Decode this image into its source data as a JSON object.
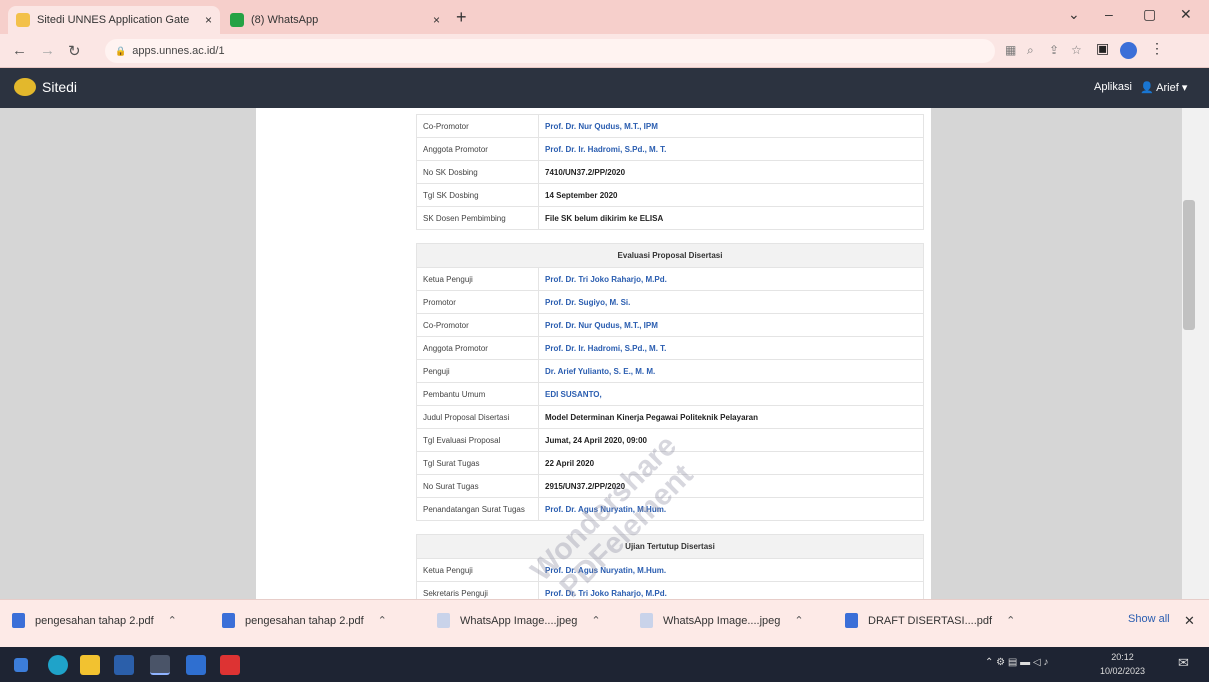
{
  "browser": {
    "tabs": [
      {
        "title": "Sitedi UNNES Application Gate",
        "close": "×"
      },
      {
        "title": "(8) WhatsApp",
        "close": "×"
      }
    ],
    "new_tab": "+",
    "url": "apps.unnes.ac.id/1"
  },
  "app": {
    "brand": "Sitedi",
    "menu_aplikasi": "Aplikasi",
    "user": "Arief"
  },
  "rows": [
    {
      "k": "Co-Promotor",
      "v": "Prof. Dr. Nur Qudus, M.T., IPM",
      "t": "link"
    },
    {
      "k": "Anggota Promotor",
      "v": "Prof. Dr. Ir. Hadromi, S.Pd., M. T.",
      "t": "link"
    },
    {
      "k": "No SK Dosbing",
      "v": "7410/UN37.2/PP/2020",
      "t": "plain"
    },
    {
      "k": "Tgl SK Dosbing",
      "v": "14 September 2020",
      "t": "plain"
    },
    {
      "k": "SK Dosen Pembimbing",
      "v": "File SK belum dikirim ke ELISA",
      "t": "plain"
    },
    {
      "t": "sp"
    },
    {
      "t": "hd",
      "v": "Evaluasi Proposal Disertasi"
    },
    {
      "k": "Ketua Penguji",
      "v": "Prof. Dr. Tri Joko Raharjo, M.Pd.",
      "t": "link"
    },
    {
      "k": "Promotor",
      "v": "Prof. Dr. Sugiyo, M. Si.",
      "t": "link"
    },
    {
      "k": "Co-Promotor",
      "v": "Prof. Dr. Nur Qudus, M.T., IPM",
      "t": "link"
    },
    {
      "k": "Anggota Promotor",
      "v": "Prof. Dr. Ir. Hadromi, S.Pd., M. T.",
      "t": "link"
    },
    {
      "k": "Penguji",
      "v": "Dr. Arief Yulianto, S. E., M. M.",
      "t": "link"
    },
    {
      "k": "Pembantu Umum",
      "v": "EDI SUSANTO,",
      "t": "link"
    },
    {
      "k": "Judul Proposal Disertasi",
      "v": "Model Determinan Kinerja Pegawai Politeknik Pelayaran",
      "t": "plain"
    },
    {
      "k": "Tgl Evaluasi Proposal",
      "v": "Jumat, 24 April 2020, 09:00",
      "t": "plain"
    },
    {
      "k": "Tgl Surat Tugas",
      "v": "22 April 2020",
      "t": "plain"
    },
    {
      "k": "No Surat Tugas",
      "v": "2915/UN37.2/PP/2020",
      "t": "plain"
    },
    {
      "k": "Penandatangan Surat Tugas",
      "v": "Prof. Dr. Agus Nuryatin, M.Hum.",
      "t": "link"
    },
    {
      "t": "sp"
    },
    {
      "t": "hd",
      "v": "Ujian Tertutup Disertasi"
    },
    {
      "k": "Ketua Penguji",
      "v": "Prof. Dr. Agus Nuryatin, M.Hum.",
      "t": "link"
    },
    {
      "k": "Sekretaris Penguji",
      "v": "Prof. Dr. Tri Joko Raharjo, M.Pd.",
      "t": "link"
    }
  ],
  "watermark": {
    "line1": "Wondershare",
    "line2": "PDFelement"
  },
  "downloads": [
    "pengesahan tahap 2.pdf",
    "pengesahan tahap 2.pdf",
    "WhatsApp Image....jpeg",
    "WhatsApp Image....jpeg",
    "DRAFT DISERTASI....pdf"
  ],
  "show_all": "Show all",
  "close_bar": "✕",
  "clock": {
    "time": "20:12",
    "date": "10/02/2023"
  },
  "colors": {
    "link": "#2a5db0",
    "navbar": "#2c3340",
    "tab_bg": "#f6cfcb"
  }
}
